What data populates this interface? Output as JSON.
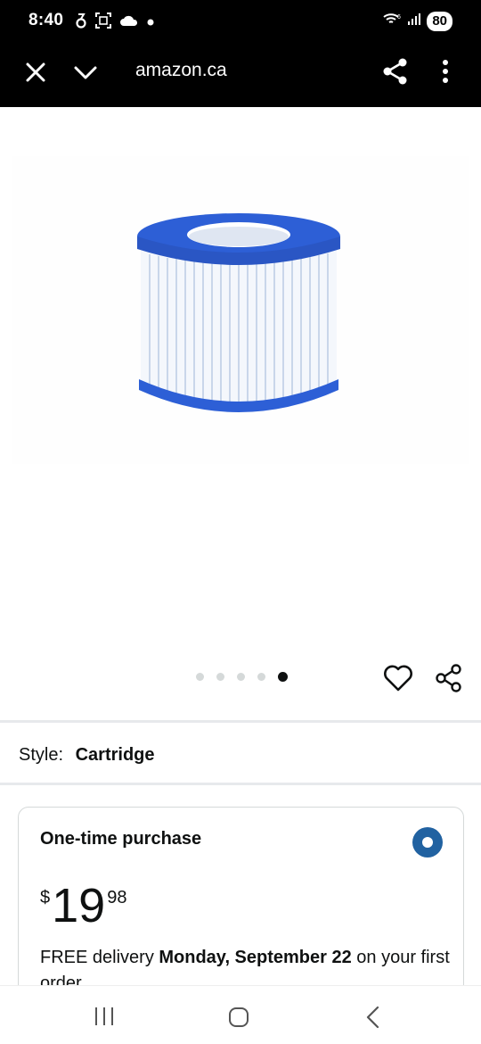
{
  "status_bar": {
    "time": "8:40",
    "battery": "80",
    "icons": [
      "nfc-icon",
      "screenshot-icon",
      "cloud-icon",
      "dot-icon",
      "wifi-icon",
      "signal-icon",
      "battery-icon"
    ]
  },
  "browser": {
    "url": "amazon.ca",
    "icons": [
      "close-icon",
      "chevron-down-icon",
      "share-icon",
      "more-vert-icon"
    ]
  },
  "gallery": {
    "image_count": 5,
    "active_index": 4,
    "icons": [
      "heart-icon",
      "share-icon"
    ]
  },
  "style": {
    "label": "Style:",
    "value": "Cartridge"
  },
  "purchase": {
    "title": "One-time purchase",
    "price_symbol": "$",
    "price_whole": "19",
    "price_fraction": "98",
    "delivery_prefix": "FREE delivery ",
    "delivery_date": "Monday, September 22",
    "delivery_suffix": " on your first order"
  },
  "colors": {
    "accent_blue": "#2162a1",
    "filter_blue": "#2d5fd6"
  },
  "nav_bar": {
    "icons": [
      "recent-apps-icon",
      "home-icon",
      "back-icon"
    ]
  }
}
